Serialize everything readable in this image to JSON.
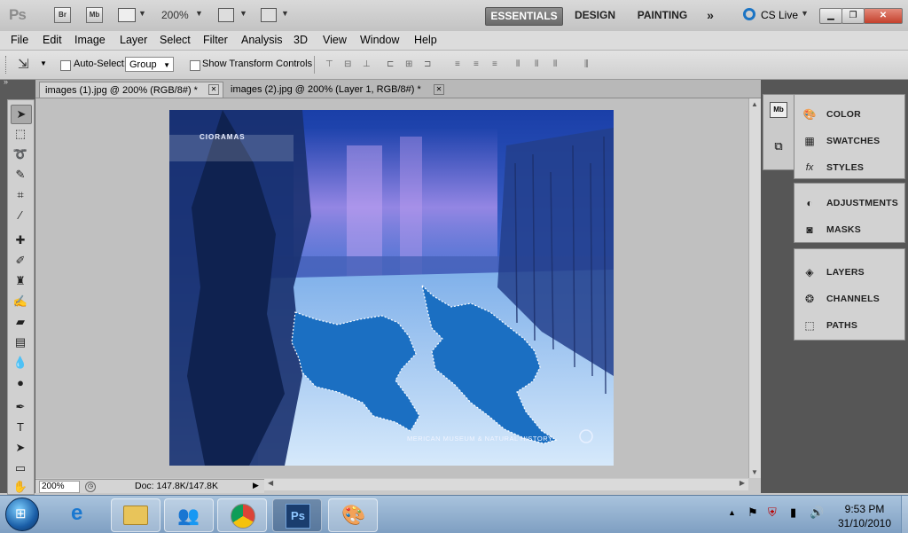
{
  "app": {
    "logo": "Ps",
    "bridge_btn": "Br",
    "minibridge_btn": "Mb",
    "zoom": "200%",
    "workspaces": [
      "ESSENTIALS",
      "DESIGN",
      "PAINTING"
    ],
    "cs_live": "CS Live"
  },
  "menu": [
    "File",
    "Edit",
    "Image",
    "Layer",
    "Select",
    "Filter",
    "Analysis",
    "3D",
    "View",
    "Window",
    "Help"
  ],
  "options": {
    "auto_select_label": "Auto-Select:",
    "auto_select_value": "Group",
    "show_transform_label": "Show Transform Controls"
  },
  "tabs": [
    {
      "title": "images (1).jpg @ 200% (RGB/8#) *"
    },
    {
      "title": "images (2).jpg @ 200% (Layer 1, RGB/8#) *"
    }
  ],
  "status": {
    "zoom": "200%",
    "doc": "Doc: 147.8K/147.8K"
  },
  "panels": {
    "group1": [
      "COLOR",
      "SWATCHES",
      "STYLES"
    ],
    "group2": [
      "ADJUSTMENTS",
      "MASKS"
    ],
    "group3": [
      "LAYERS",
      "CHANNELS",
      "PATHS"
    ]
  },
  "image_text": {
    "watermark_top": "CIORAMAS",
    "watermark_bottom": "MERICAN MUSEUM & NATURAL HISTORY"
  },
  "taskbar": {
    "time": "9:53 PM",
    "date": "31/10/2010"
  },
  "colors": {
    "accent_selection": "#1e6fc0",
    "workspace_active": "#7a7a7a"
  }
}
